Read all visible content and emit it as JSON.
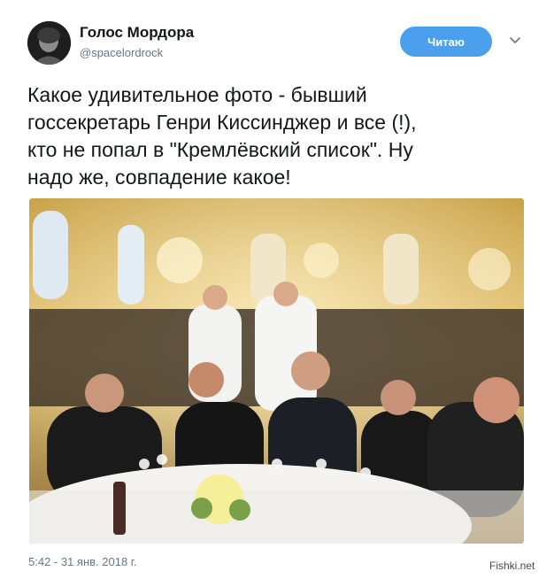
{
  "author": {
    "name": "Голос Мордора",
    "handle": "@spacelordrock"
  },
  "follow_button": {
    "label": "Читаю",
    "color": "#4aa0ec"
  },
  "menu_icon": "chevron-down-icon",
  "tweet": {
    "text_lines": [
      "Какое удивительное фото - бывший",
      "госсекретарь Генри Киссинджер и все (!),",
      "кто не попал в \"Кремлёвский список\". Ну",
      "надо же, совпадение какое!"
    ],
    "timestamp": "5:42 - 31 янв. 2018 г."
  },
  "watermark": "Fishki.net"
}
